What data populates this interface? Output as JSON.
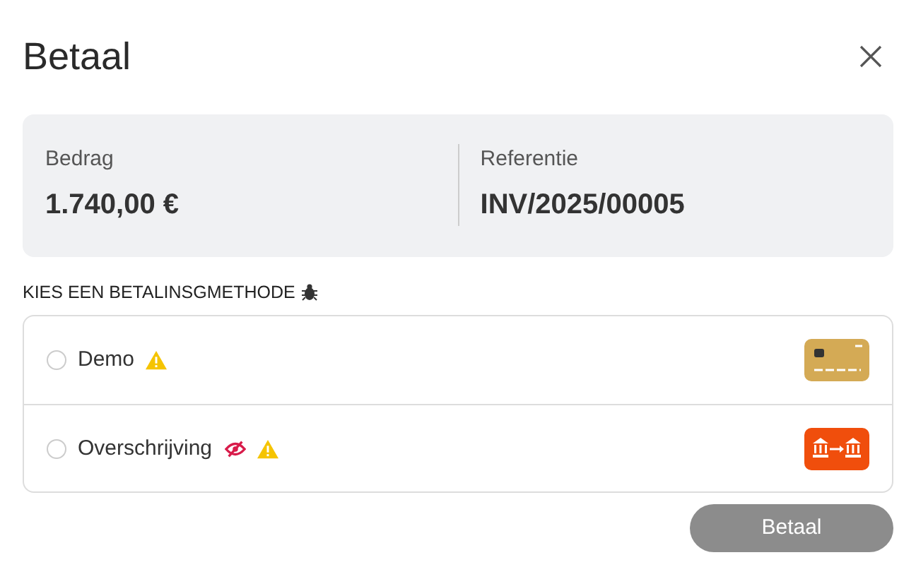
{
  "dialog": {
    "title": "Betaal"
  },
  "summary": [
    {
      "label": "Bedrag",
      "value": "1.740,00 €"
    },
    {
      "label": "Referentie",
      "value": "INV/2025/00005"
    }
  ],
  "methods_heading": "KIES EEN BETALINSGMETHODE",
  "methods": [
    {
      "name": "Demo",
      "kind": "card",
      "selected": false,
      "hidden": false,
      "warning": true
    },
    {
      "name": "Overschrijving",
      "kind": "transfer",
      "selected": false,
      "hidden": true,
      "warning": true
    }
  ],
  "submit": {
    "label": "Betaal",
    "disabled": true
  }
}
